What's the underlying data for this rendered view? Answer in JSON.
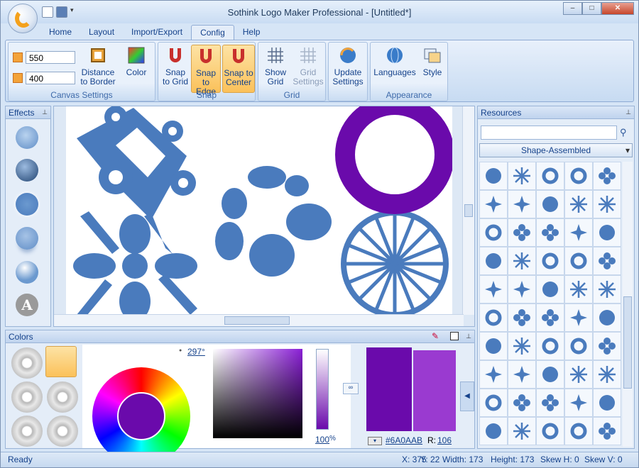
{
  "app": {
    "title": "Sothink Logo Maker Professional - [Untitled*]"
  },
  "window_buttons": {
    "minimize": "–",
    "maximize": "□",
    "close": "✕"
  },
  "tabs": [
    "Home",
    "Layout",
    "Import/Export",
    "Config",
    "Help"
  ],
  "active_tab": "Config",
  "ribbon": {
    "canvas": {
      "width_value": "550",
      "height_value": "400",
      "distance_label": "Distance to Border",
      "color_label": "Color",
      "group": "Canvas Settings"
    },
    "snap": {
      "grid_label": "Snap to Grid",
      "edge_label": "Snap to Edge",
      "center_label": "Snap to Center",
      "group": "Snap"
    },
    "grid": {
      "show_label": "Show Grid",
      "settings_label": "Grid Settings",
      "group": "Grid"
    },
    "update": {
      "label": "Update Settings"
    },
    "appearance": {
      "languages_label": "Languages",
      "style_label": "Style",
      "group": "Appearance"
    }
  },
  "effects": {
    "title": "Effects",
    "letter": "A"
  },
  "resources": {
    "title": "Resources",
    "search_placeholder": "",
    "category": "Shape-Assembled"
  },
  "colors_panel": {
    "title": "Colors",
    "angle": "297°",
    "opacity": "100",
    "opacity_unit": "%",
    "hex": "#6A0AAB",
    "r_label": "R:",
    "r_value": "106"
  },
  "colors": {
    "accent": "#6a0aab",
    "shape": "#4a7bbd",
    "ring": "#6a0aab"
  },
  "status": {
    "text": "Ready",
    "x": "X: 375",
    "y": "Y: 22",
    "width": "Width: 173",
    "height": "Height: 173",
    "skewh": "Skew H: 0",
    "skewv": "Skew V: 0"
  }
}
